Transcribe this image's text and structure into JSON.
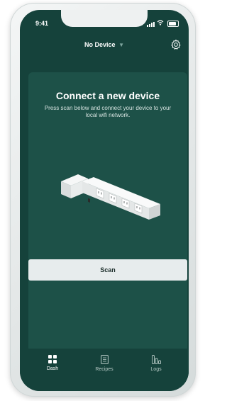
{
  "status_bar": {
    "time": "9:41"
  },
  "header": {
    "device_selector": "No Device",
    "dropdown_arrow": "▼"
  },
  "card": {
    "title": "Connect a new device",
    "subtitle": "Press scan below and connect your device to your local wifi network.",
    "scan_label": "Scan"
  },
  "tabbar": {
    "items": [
      {
        "label": "Dash",
        "icon": "grid-icon",
        "active": true
      },
      {
        "label": "Recipes",
        "icon": "document-icon",
        "active": false
      },
      {
        "label": "Logs",
        "icon": "bar-chart-icon",
        "active": false
      }
    ]
  },
  "colors": {
    "screen_bg": "#15423b",
    "card_bg": "#1d5148",
    "button_bg": "#e7eced",
    "text_light": "#ffffff"
  }
}
